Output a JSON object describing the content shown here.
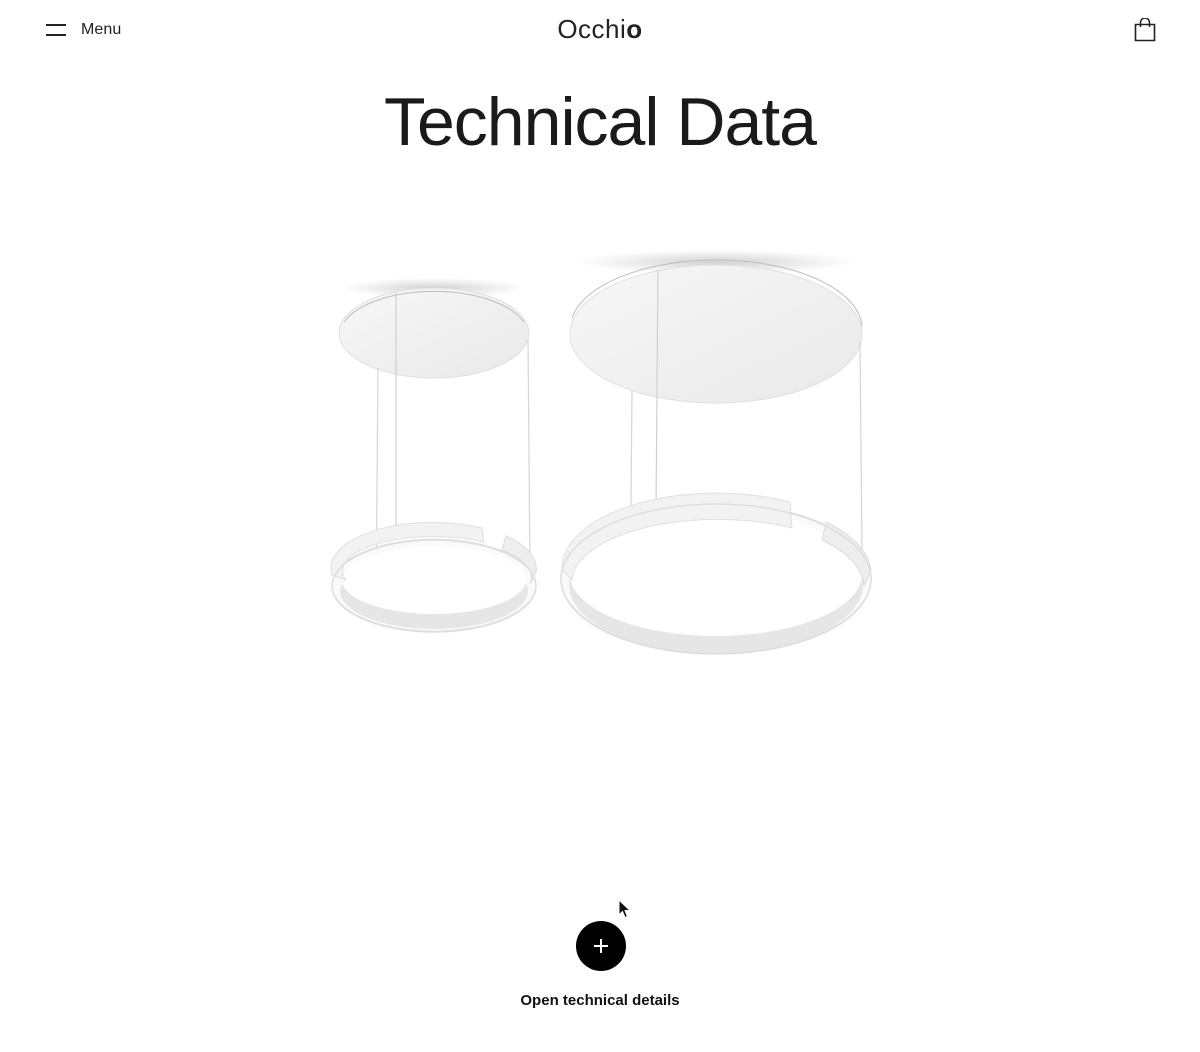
{
  "header": {
    "menu_label": "Menu",
    "logo_text": "Occhi",
    "logo_accent": "o",
    "menu_icon": "hamburger-icon",
    "cart_icon": "shopping-bag-icon"
  },
  "main": {
    "title": "Technical Data",
    "image_subject": "product-pendant-lights-image"
  },
  "details": {
    "toggle_icon": "plus-icon",
    "toggle_label": "Open technical details"
  },
  "colors": {
    "text": "#111111",
    "background": "#ffffff",
    "button": "#000000"
  }
}
